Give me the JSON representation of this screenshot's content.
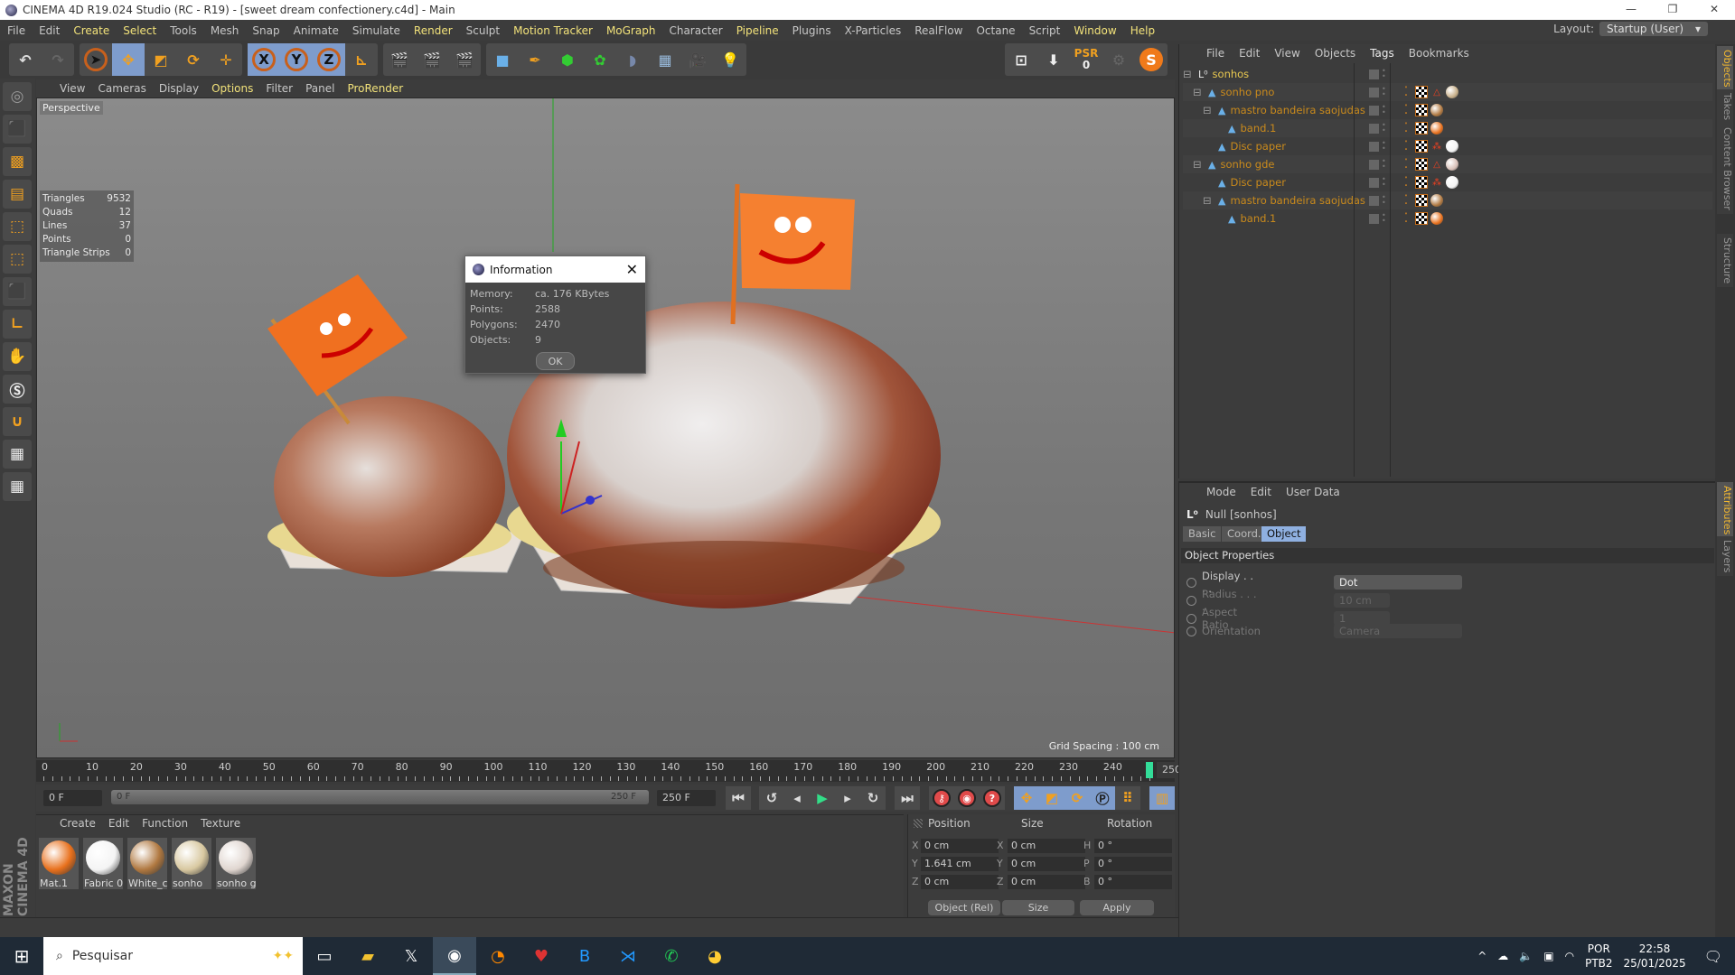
{
  "window": {
    "title": "CINEMA 4D R19.024 Studio (RC - R19) - [sweet dream confectionery.c4d] - Main",
    "minimize": "—",
    "restore": "❐",
    "close": "✕"
  },
  "menu": [
    {
      "label": "File",
      "hl": false
    },
    {
      "label": "Edit",
      "hl": false
    },
    {
      "label": "Create",
      "hl": true
    },
    {
      "label": "Select",
      "hl": true
    },
    {
      "label": "Tools",
      "hl": false
    },
    {
      "label": "Mesh",
      "hl": false
    },
    {
      "label": "Snap",
      "hl": false
    },
    {
      "label": "Animate",
      "hl": false
    },
    {
      "label": "Simulate",
      "hl": false
    },
    {
      "label": "Render",
      "hl": true
    },
    {
      "label": "Sculpt",
      "hl": false
    },
    {
      "label": "Motion Tracker",
      "hl": true
    },
    {
      "label": "MoGraph",
      "hl": true
    },
    {
      "label": "Character",
      "hl": false
    },
    {
      "label": "Pipeline",
      "hl": true
    },
    {
      "label": "Plugins",
      "hl": false
    },
    {
      "label": "X-Particles",
      "hl": false
    },
    {
      "label": "RealFlow",
      "hl": false
    },
    {
      "label": "Octane",
      "hl": false
    },
    {
      "label": "Script",
      "hl": false
    },
    {
      "label": "Window",
      "hl": true
    },
    {
      "label": "Help",
      "hl": true
    }
  ],
  "layout": {
    "label": "Layout:",
    "value": "Startup (User)"
  },
  "toolbar": {
    "x": "X",
    "y": "Y",
    "z": "Z",
    "psr": "PSR",
    "psr_value": "0"
  },
  "viewport": {
    "menu": [
      {
        "label": "View",
        "hl": false
      },
      {
        "label": "Cameras",
        "hl": false
      },
      {
        "label": "Display",
        "hl": false
      },
      {
        "label": "Options",
        "hl": true
      },
      {
        "label": "Filter",
        "hl": false
      },
      {
        "label": "Panel",
        "hl": false
      },
      {
        "label": "ProRender",
        "hl": true
      }
    ],
    "camera": "Perspective",
    "grid_spacing": "Grid Spacing : 100 cm",
    "stats": [
      {
        "k": "Triangles",
        "v": "9532"
      },
      {
        "k": "Quads",
        "v": "12"
      },
      {
        "k": "Lines",
        "v": "37"
      },
      {
        "k": "Points",
        "v": "0"
      },
      {
        "k": "Triangle Strips",
        "v": "0"
      }
    ]
  },
  "dialog": {
    "title": "Information",
    "rows": [
      {
        "k": "Memory:",
        "v": "ca. 176 KBytes"
      },
      {
        "k": "Points:",
        "v": "2588"
      },
      {
        "k": "Polygons:",
        "v": "2470"
      },
      {
        "k": "Objects:",
        "v": "9"
      }
    ],
    "ok": "OK"
  },
  "timeline": {
    "labels": [
      "0",
      "10",
      "20",
      "30",
      "40",
      "50",
      "60",
      "70",
      "80",
      "90",
      "100",
      "110",
      "120",
      "130",
      "140",
      "150",
      "160",
      "170",
      "180",
      "190",
      "200",
      "210",
      "220",
      "230",
      "240"
    ],
    "current": "250 F",
    "start": "0 F",
    "range_start": "0 F",
    "range_end": "250 F",
    "end": "250 F",
    "current_frame_fraction": 1.0
  },
  "materials": {
    "menu": [
      "Create",
      "Edit",
      "Function",
      "Texture"
    ],
    "items": [
      {
        "name": "Mat.1",
        "color": "#e8701c"
      },
      {
        "name": "Fabric 0",
        "color": "#f4f4f4"
      },
      {
        "name": "White_c",
        "color": "#b07840"
      },
      {
        "name": "sonho",
        "color": "#d8c8a0"
      },
      {
        "name": "sonho g",
        "color": "#e0d6d0"
      }
    ]
  },
  "coords": {
    "headers": [
      "Position",
      "Size",
      "Rotation"
    ],
    "rows": [
      {
        "a": "X",
        "pos": "0 cm",
        "b": "X",
        "size": "0 cm",
        "c": "H",
        "rot": "0 °"
      },
      {
        "a": "Y",
        "pos": "1.641 cm",
        "b": "Y",
        "size": "0 cm",
        "c": "P",
        "rot": "0 °"
      },
      {
        "a": "Z",
        "pos": "0 cm",
        "b": "Z",
        "size": "0 cm",
        "c": "B",
        "rot": "0 °"
      }
    ],
    "mode": "Object (Rel)",
    "size_mode": "Size",
    "apply": "Apply"
  },
  "objects": {
    "menu": [
      {
        "label": "File",
        "hl": false
      },
      {
        "label": "Edit",
        "hl": false
      },
      {
        "label": "View",
        "hl": false
      },
      {
        "label": "Objects",
        "hl": false
      },
      {
        "label": "Tags",
        "hl": true
      },
      {
        "label": "Bookmarks",
        "hl": false
      }
    ],
    "tree": [
      {
        "name": "sonhos",
        "depth": 0,
        "root": true,
        "tags": []
      },
      {
        "name": "sonho pno",
        "depth": 1,
        "tags": [
          "phong",
          "check",
          "tri",
          "mat:#c8b08a"
        ]
      },
      {
        "name": "mastro bandeira saojudas",
        "depth": 2,
        "tags": [
          "phong",
          "check",
          "mat:#b07840"
        ]
      },
      {
        "name": "band.1",
        "depth": 3,
        "tags": [
          "phong",
          "check",
          "mat:#e8701c"
        ]
      },
      {
        "name": "Disc paper",
        "depth": 2,
        "tags": [
          "phong",
          "check",
          "dots",
          "mat:#f4f4f4"
        ]
      },
      {
        "name": "sonho gde",
        "depth": 1,
        "tags": [
          "phong",
          "check",
          "tri",
          "mat:#d8c0b8"
        ]
      },
      {
        "name": "Disc paper",
        "depth": 2,
        "tags": [
          "phong",
          "check",
          "dots",
          "mat:#f4f4f4"
        ]
      },
      {
        "name": "mastro bandeira saojudas",
        "depth": 2,
        "tags": [
          "phong",
          "check",
          "mat:#b07840"
        ]
      },
      {
        "name": "band.1",
        "depth": 3,
        "tags": [
          "phong",
          "check",
          "mat:#e8701c"
        ]
      }
    ]
  },
  "attributes": {
    "menu": [
      "Mode",
      "Edit",
      "User Data"
    ],
    "object": "Null [sonhos]",
    "tabs": [
      {
        "label": "Basic",
        "on": false
      },
      {
        "label": "Coord.",
        "on": false
      },
      {
        "label": "Object",
        "on": true
      }
    ],
    "section": "Object Properties",
    "props": [
      {
        "label": "Display . . . .",
        "value": "Dot",
        "enabled": true
      },
      {
        "label": "Radius . . . .",
        "value": "10 cm",
        "enabled": false
      },
      {
        "label": "Aspect Ratio",
        "value": "1",
        "enabled": false
      },
      {
        "label": "Orientation",
        "value": "Camera",
        "enabled": false
      }
    ]
  },
  "side_tabs": [
    {
      "label": "Objects",
      "on": true
    },
    {
      "label": "Takes",
      "on": false
    },
    {
      "label": "Content Browser",
      "on": false
    },
    {
      "label": "Structure",
      "on": false
    },
    {
      "label": "Attributes",
      "on": true
    },
    {
      "label": "Layers",
      "on": false
    }
  ],
  "branding": "MAXON CINEMA 4D",
  "taskbar": {
    "search": "Pesquisar",
    "lang1": "POR",
    "lang2": "PTB2",
    "time": "22:58",
    "date": "25/01/2025"
  },
  "colors": {
    "accent": "#f2e27a",
    "object": "#c98a1c",
    "selected_tab": "#8fb0e0"
  }
}
